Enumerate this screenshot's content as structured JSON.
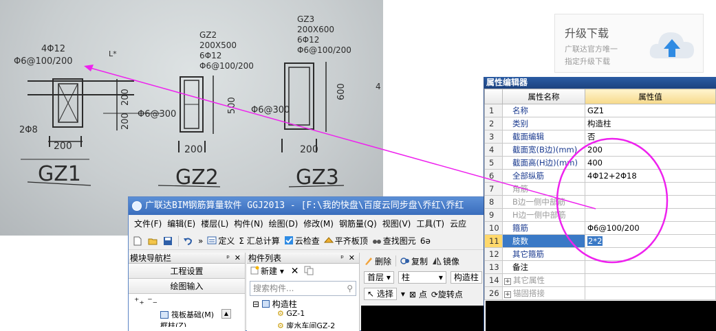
{
  "photo": {
    "gz1": {
      "name": "GZ1",
      "top_rebar": "4Φ12",
      "stirrup": "Φ6@100/200",
      "dim_top": "L*",
      "dim_right_a": "200",
      "dim_right_b": "200",
      "side_stirrup": "Φ6@300",
      "bottom_rebar": "2Φ8",
      "dim_bottom": "200"
    },
    "gz2": {
      "name": "GZ2",
      "l1": "GZ2",
      "l2": "200X500",
      "l3": "6Φ12",
      "l4": "Φ6@100/200",
      "dim_right": "500",
      "side_stirrup": "Φ6@300",
      "dim_bottom": "200"
    },
    "gz3": {
      "name": "GZ3",
      "l1": "GZ3",
      "l2": "200X600",
      "l3": "6Φ12",
      "l4": "Φ6@100/200",
      "dim_right": "600",
      "dim_bottom": "200"
    },
    "edge_mark": "4"
  },
  "ad": {
    "title": "升级下载",
    "line1": "广联达官方唯一",
    "line2": "指定升级下载"
  },
  "window": {
    "title": "广联达BIM钢筋算量软件 GGJ2013 - [F:\\我的快盘\\百度云同步盘\\乔红\\乔红",
    "menu": [
      "文件(F)",
      "编辑(E)",
      "楼层(L)",
      "构件(N)",
      "绘图(D)",
      "修改(M)",
      "钢筋量(Q)",
      "视图(V)",
      "工具(T)",
      "云应"
    ],
    "toolbar": {
      "more": "»",
      "define": "定义",
      "sum": "Σ 汇总计算",
      "cloud_check": "云检查",
      "flat_slab": "平齐板顶",
      "find": "查找图元",
      "extra": "6ə"
    },
    "nav": {
      "header": "模块导航栏",
      "btn1": "工程设置",
      "btn2": "绘图输入",
      "item1": "筏板基础(M)",
      "item2": "框柱(Z)"
    },
    "list": {
      "header": "构件列表",
      "new": "新建",
      "search": "搜索构件...",
      "root": "构造柱",
      "child1": "GZ-1",
      "child2": "废水车间GZ-2"
    },
    "right": {
      "delete": "删除",
      "copy": "复制",
      "mirror": "镜像",
      "floor": "首层",
      "type": "柱",
      "type2": "构造柱",
      "select": "选择",
      "point": "点",
      "rotate_point": "旋转点"
    }
  },
  "prop": {
    "title": "属性编辑器",
    "col_name": "属性名称",
    "col_value": "属性值",
    "rows": [
      {
        "num": "1",
        "name": "名称",
        "value": "GZ1"
      },
      {
        "num": "2",
        "name": "类别",
        "value": "构造柱"
      },
      {
        "num": "3",
        "name": "截面编辑",
        "value": "否"
      },
      {
        "num": "4",
        "name": "截面宽(B边)(mm)",
        "value": "200"
      },
      {
        "num": "5",
        "name": "截面高(H边)(mm)",
        "value": "400"
      },
      {
        "num": "6",
        "name": "全部纵筋",
        "value": "4Φ12+2Φ18"
      },
      {
        "num": "7",
        "name": "角筋",
        "value": ""
      },
      {
        "num": "8",
        "name": "B边一侧中部筋",
        "value": ""
      },
      {
        "num": "9",
        "name": "H边一侧中部筋",
        "value": ""
      },
      {
        "num": "10",
        "name": "箍筋",
        "value": "Φ6@100/200"
      },
      {
        "num": "11",
        "name": "肢数",
        "value": "2*2"
      },
      {
        "num": "12",
        "name": "其它箍筋",
        "value": ""
      },
      {
        "num": "13",
        "name": "备注",
        "value": ""
      },
      {
        "num": "14",
        "name": "其它属性",
        "value": ""
      },
      {
        "num": "26",
        "name": "锚固搭接",
        "value": ""
      }
    ]
  },
  "colors": {
    "arrow": "#ee22ee",
    "highlight": "#3a79c6",
    "title_bar": "#3a6dbd"
  }
}
